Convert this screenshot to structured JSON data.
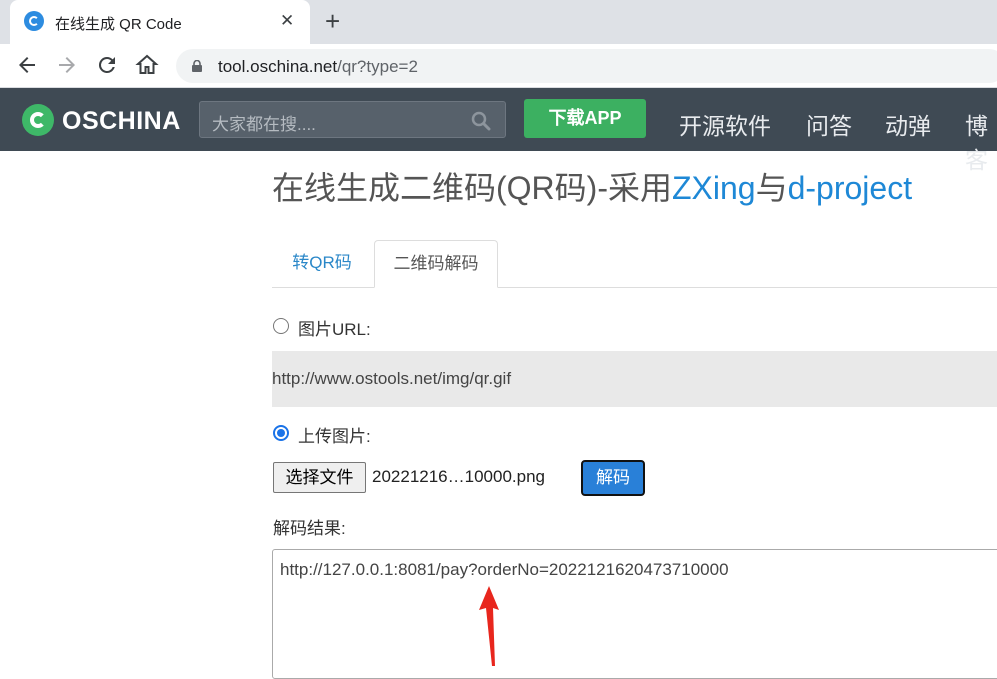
{
  "browser": {
    "tab_title": "在线生成 QR Code",
    "tab_close": "✕",
    "new_tab": "+",
    "url_host": "tool.oschina.net",
    "url_path": "/qr?type=2"
  },
  "header": {
    "logo_text": "OSCHINA",
    "search_placeholder": "大家都在搜....",
    "download_button": "下载APP",
    "nav": [
      "开源软件",
      "问答",
      "动弹",
      "博客"
    ]
  },
  "page": {
    "title_prefix": "在线生成二维码(QR码)-采用",
    "title_link1": "ZXing",
    "title_mid": "与",
    "title_link2": "d-project",
    "tabs": [
      {
        "label": "转QR码",
        "active": false
      },
      {
        "label": "二维码解码",
        "active": true
      }
    ],
    "image_url_label": "图片URL:",
    "image_url_value": "http://www.ostools.net/img/qr.gif",
    "upload_label": "上传图片:",
    "choose_file_button": "选择文件",
    "file_name": "20221216…10000.png",
    "decode_button": "解码",
    "result_label": "解码结果:",
    "result_text": "http://127.0.0.1:8081/pay?orderNo=2022121620473710000"
  },
  "colors": {
    "header_bg": "#3f4a54",
    "brand_green": "#3cb061",
    "link_blue": "#1e88d6",
    "annotation_red": "#e8261d"
  }
}
